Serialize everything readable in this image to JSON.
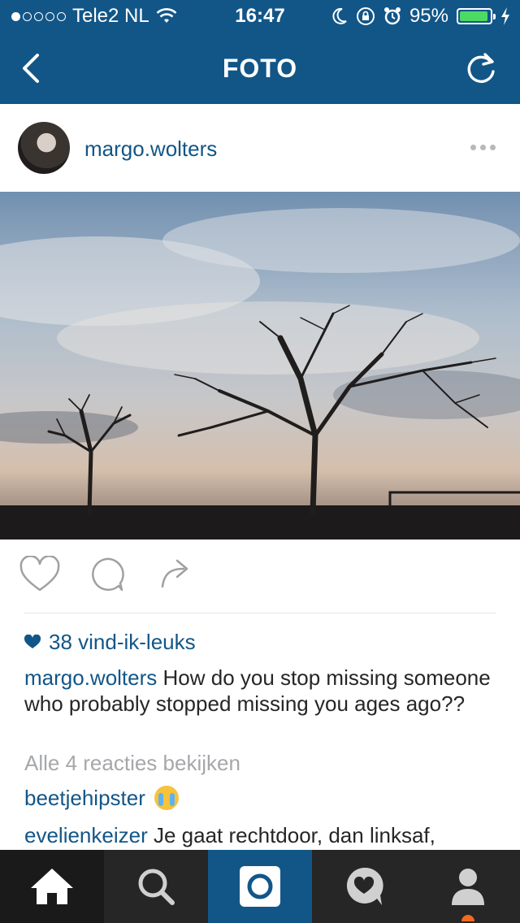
{
  "status_bar": {
    "carrier": "Tele2 NL",
    "signal_dots_filled": 1,
    "signal_dots_total": 5,
    "time": "16:47",
    "battery_percent": "95%",
    "battery_level": 0.95
  },
  "nav": {
    "title": "FOTO",
    "back_icon": "chevron-left-icon",
    "refresh_icon": "refresh-icon"
  },
  "post": {
    "username": "margo.wolters",
    "more_icon": "more-dots-icon",
    "photo": "sunset-sky-bare-trees-photo"
  },
  "actions": {
    "like_icon": "heart-icon",
    "comment_icon": "comment-bubble-icon",
    "share_icon": "share-arrow-icon"
  },
  "likes": {
    "text": "38 vind-ik-leuks"
  },
  "caption": {
    "author": "margo.wolters",
    "text": "How do you stop missing someone who probably stopped missing you ages ago??"
  },
  "view_all_comments": "Alle 4 reacties bekijken",
  "comments": [
    {
      "author": "beetjehipster",
      "text": "",
      "emoji": "loudly-crying-face-emoji"
    },
    {
      "author": "evelienkeizer",
      "text": "Je gaat rechtdoor, dan linksaf,"
    }
  ],
  "tabbar": {
    "items": [
      {
        "icon": "home-icon",
        "active": true
      },
      {
        "icon": "search-icon",
        "active": false
      },
      {
        "icon": "camera-icon",
        "active": false
      },
      {
        "icon": "activity-heart-icon",
        "active": false
      },
      {
        "icon": "profile-icon",
        "active": false
      }
    ]
  },
  "colors": {
    "brand": "#125688",
    "tabbar": "#262626",
    "notification": "#f26b21",
    "muted_text": "#a5a7aa"
  }
}
